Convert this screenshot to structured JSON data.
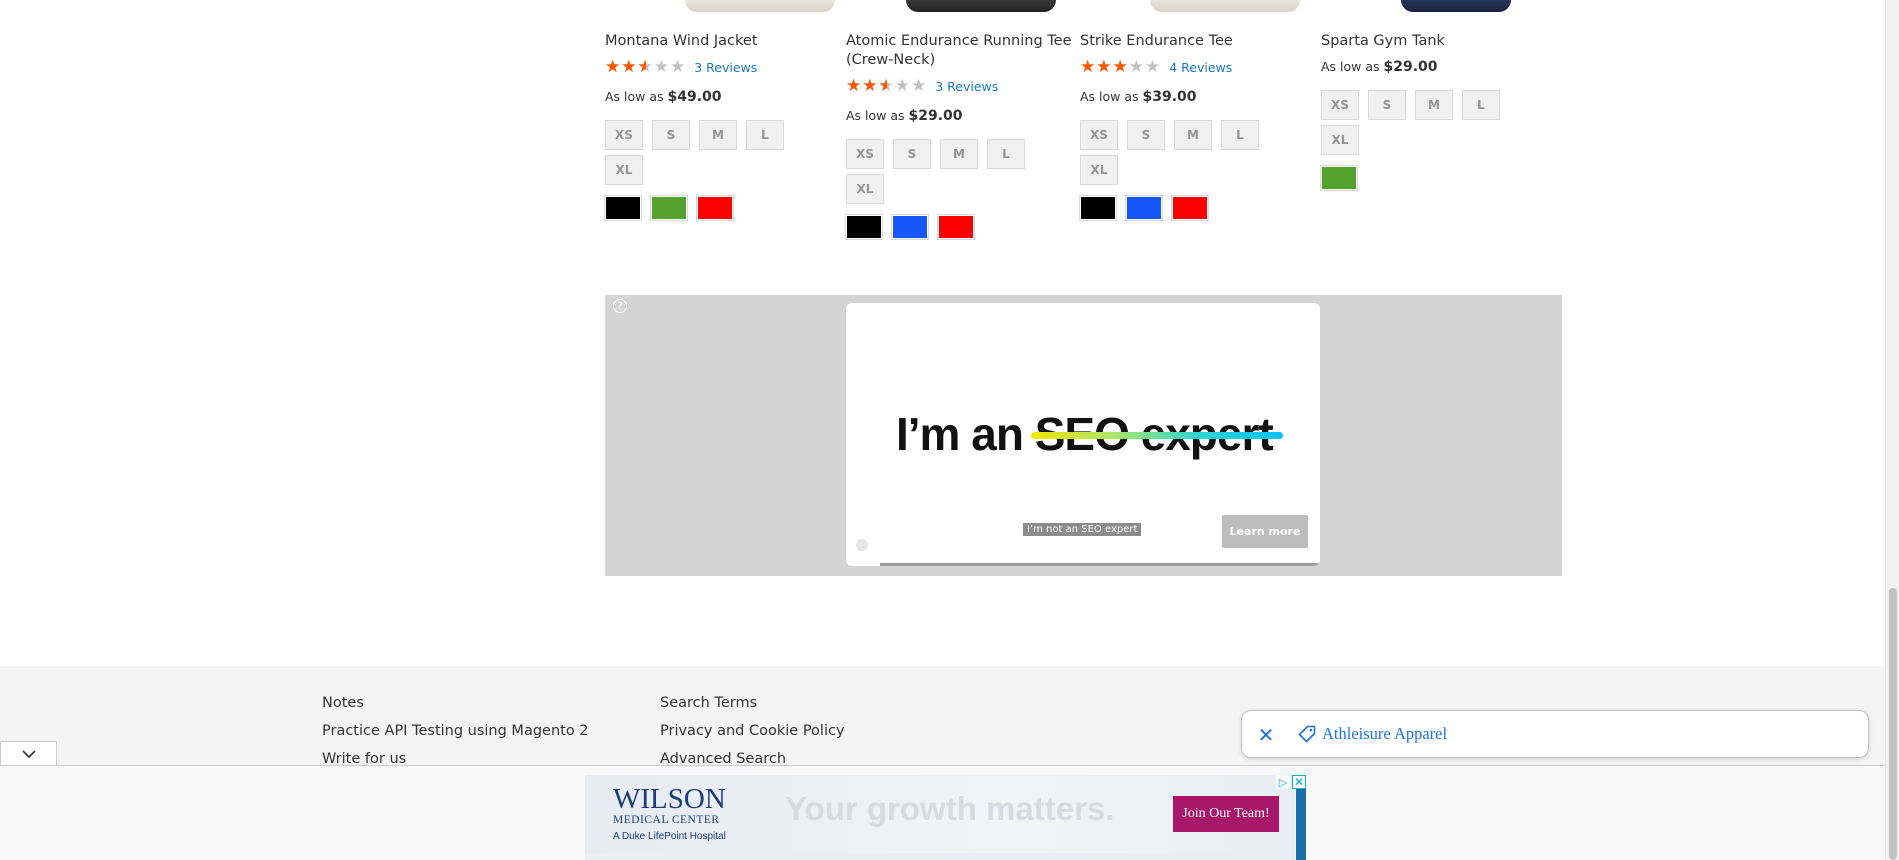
{
  "products": [
    {
      "name": "Montana Wind Jacket",
      "rating": 0.5,
      "reviews": "3 Reviews",
      "price_prefix": "As low as",
      "price": "$49.00",
      "sizes": [
        "XS",
        "S",
        "M",
        "L",
        "XL"
      ],
      "colors": [
        "#000000",
        "#53a22b",
        "#ff0000"
      ]
    },
    {
      "name": "Atomic Endurance Running Tee (Crew-Neck)",
      "rating": 0.5,
      "reviews": "3 Reviews",
      "price_prefix": "As low as",
      "price": "$29.00",
      "sizes": [
        "XS",
        "S",
        "M",
        "L",
        "XL"
      ],
      "colors": [
        "#000000",
        "#1857f7",
        "#ff0000"
      ]
    },
    {
      "name": "Strike Endurance Tee",
      "rating": 0.6,
      "reviews": "4 Reviews",
      "price_prefix": "As low as",
      "price": "$39.00",
      "sizes": [
        "XS",
        "S",
        "M",
        "L",
        "XL"
      ],
      "colors": [
        "#000000",
        "#1857f7",
        "#ff0000"
      ]
    },
    {
      "name": "Sparta Gym Tank",
      "rating": null,
      "reviews": "",
      "price_prefix": "As low as",
      "price": "$29.00",
      "sizes": [
        "XS",
        "S",
        "M",
        "L",
        "XL"
      ],
      "colors": [
        "#53a22b"
      ]
    }
  ],
  "video_ad": {
    "help_icon": "question-circle-icon",
    "headline_plain": "I’m an ",
    "headline_struck": "SEO expert",
    "caption": "I’m not an SEO expert",
    "cta": "Learn more"
  },
  "footer": {
    "col1": [
      "Notes",
      "Practice API Testing using Magento 2",
      "Write for us"
    ],
    "col2": [
      "Search Terms",
      "Privacy and Cookie Policy",
      "Advanced Search"
    ]
  },
  "search_chip": {
    "label": "Athleisure Apparel",
    "close_icon": "close-icon",
    "tag_icon": "tag-icon"
  },
  "banner_ad": {
    "brand_line1": "WILSON",
    "brand_line2": "MEDICAL CENTER",
    "brand_line3": "A Duke LifePoint Hospital",
    "tagline": "Your growth matters.",
    "cta": "Join Our Team!",
    "brand_color": "#1d3c78",
    "cta_color": "#a6176a"
  }
}
